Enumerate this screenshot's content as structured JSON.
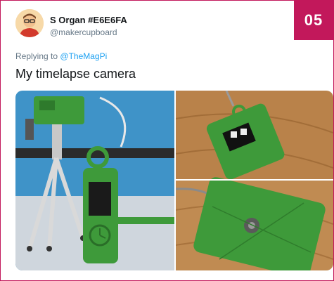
{
  "badge": {
    "number": "05"
  },
  "tweet": {
    "author_name": "S Organ #E6E6FA",
    "author_handle": "@makercupboard",
    "reply_prefix": "Replying to",
    "reply_to": "@TheMagPi",
    "text": "My timelapse camera"
  },
  "media": {
    "images": [
      {
        "name": "timelapse-camera-on-tripod-photo"
      },
      {
        "name": "camera-screen-front-photo"
      },
      {
        "name": "camera-back-photo"
      }
    ]
  },
  "colors": {
    "accent": "#c2185b",
    "link": "#1da1f2",
    "text": "#14171a",
    "muted": "#657786",
    "case_green": "#3e9a3a"
  }
}
